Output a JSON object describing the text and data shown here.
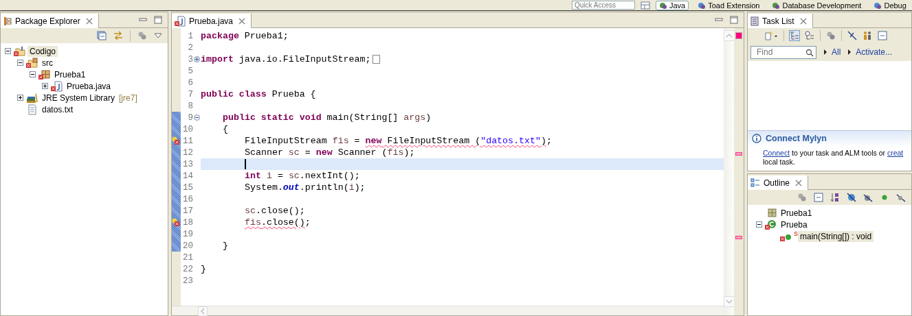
{
  "toolbar": {
    "quick_access": {
      "placeholder": "Quick Access"
    },
    "perspectives": [
      {
        "label": "Java",
        "selected": true
      },
      {
        "label": "Toad Extension",
        "selected": false
      },
      {
        "label": "Database Development",
        "selected": false
      },
      {
        "label": "Debug",
        "selected": false
      }
    ]
  },
  "package_explorer": {
    "title": "Package Explorer",
    "tree": [
      {
        "label": "Codigo",
        "kind": "project",
        "expanded": true,
        "selected": true,
        "error": true,
        "children": [
          {
            "label": "src",
            "kind": "source-folder",
            "expanded": true,
            "selected": false,
            "error": true,
            "children": [
              {
                "label": "Prueba1",
                "kind": "package",
                "expanded": true,
                "selected": false,
                "error": true,
                "children": [
                  {
                    "label": "Prueba.java",
                    "kind": "java-file",
                    "expanded": false,
                    "selected": false,
                    "error": true
                  }
                ]
              }
            ]
          },
          {
            "label": "JRE System Library",
            "decoration": "[jre7]",
            "kind": "library",
            "expanded": false,
            "selected": false,
            "error": false
          },
          {
            "label": "datos.txt",
            "kind": "text-file",
            "selected": false,
            "error": false
          }
        ]
      }
    ]
  },
  "editor": {
    "tab": {
      "title": "Prueba.java",
      "error": true
    },
    "lines": [
      {
        "number": "1",
        "error": false,
        "changed": false,
        "current": false,
        "segments": [
          {
            "t": "package",
            "kind": "keyword",
            "squiggly": false
          },
          {
            "t": " Prueba1;",
            "kind": "plain",
            "squiggly": false
          }
        ]
      },
      {
        "number": "2",
        "error": false,
        "changed": false,
        "current": false
      },
      {
        "number": "3",
        "expanded": false,
        "error": false,
        "changed": false,
        "current": false,
        "segments": [
          {
            "t": "import",
            "kind": "keyword",
            "squiggly": false
          },
          {
            "t": " java.io.FileInputStream;",
            "kind": "plain",
            "squiggly": false
          }
        ]
      },
      {
        "number": "5",
        "error": false,
        "changed": false,
        "current": false
      },
      {
        "number": "6",
        "error": false,
        "changed": false,
        "current": false
      },
      {
        "number": "7",
        "error": false,
        "changed": false,
        "current": false,
        "segments": [
          {
            "t": "public class",
            "kind": "keyword",
            "squiggly": false
          },
          {
            "t": " Prueba {",
            "kind": "plain",
            "squiggly": false
          }
        ],
        "children": [
          {
            "number": "8",
            "error": false,
            "changed": false,
            "current": false
          },
          {
            "number": "9",
            "expanded": true,
            "error": false,
            "changed": true,
            "current": false,
            "segments": [
              {
                "t": "public static void",
                "kind": "keyword",
                "squiggly": false
              },
              {
                "t": " main(String[] ",
                "kind": "plain",
                "squiggly": false
              },
              {
                "t": "args",
                "kind": "variable",
                "squiggly": false
              },
              {
                "t": ")",
                "kind": "plain",
                "squiggly": false
              }
            ]
          },
          {
            "number": "10",
            "error": false,
            "changed": true,
            "current": false,
            "segments": [
              {
                "t": "{",
                "kind": "plain",
                "squiggly": false
              }
            ],
            "children": [
              {
                "number": "11",
                "error": true,
                "changed": true,
                "current": false,
                "segments": [
                  {
                    "t": "FileInputStream ",
                    "kind": "plain",
                    "squiggly": false
                  },
                  {
                    "t": "fis",
                    "kind": "variable",
                    "squiggly": false
                  },
                  {
                    "t": " = ",
                    "kind": "plain",
                    "squiggly": false
                  },
                  {
                    "t": "new",
                    "kind": "keyword",
                    "squiggly": true
                  },
                  {
                    "t": " FileInputStream (",
                    "kind": "plain",
                    "squiggly": true
                  },
                  {
                    "t": "\"datos.txt\"",
                    "kind": "string",
                    "squiggly": true
                  },
                  {
                    "t": ")",
                    "kind": "plain",
                    "squiggly": true
                  },
                  {
                    "t": ";",
                    "kind": "plain",
                    "squiggly": false
                  }
                ]
              },
              {
                "number": "12",
                "error": false,
                "changed": true,
                "current": false,
                "segments": [
                  {
                    "t": "Scanner ",
                    "kind": "plain",
                    "squiggly": false
                  },
                  {
                    "t": "sc",
                    "kind": "variable",
                    "squiggly": false
                  },
                  {
                    "t": " = ",
                    "kind": "plain",
                    "squiggly": false
                  },
                  {
                    "t": "new",
                    "kind": "keyword",
                    "squiggly": false
                  },
                  {
                    "t": " Scanner (",
                    "kind": "plain",
                    "squiggly": false
                  },
                  {
                    "t": "fis",
                    "kind": "variable",
                    "squiggly": false
                  },
                  {
                    "t": ");",
                    "kind": "plain",
                    "squiggly": false
                  }
                ]
              },
              {
                "number": "13",
                "error": false,
                "changed": true,
                "current": true
              },
              {
                "number": "14",
                "error": false,
                "changed": true,
                "current": false,
                "segments": [
                  {
                    "t": "int",
                    "kind": "keyword",
                    "squiggly": false
                  },
                  {
                    "t": " i",
                    "kind": "variable",
                    "squiggly": false
                  },
                  {
                    "t": " = ",
                    "kind": "plain",
                    "squiggly": false
                  },
                  {
                    "t": "sc",
                    "kind": "variable",
                    "squiggly": false
                  },
                  {
                    "t": ".nextInt();",
                    "kind": "plain",
                    "squiggly": false
                  }
                ]
              },
              {
                "number": "15",
                "error": false,
                "changed": true,
                "current": false,
                "segments": [
                  {
                    "t": "System.",
                    "kind": "plain",
                    "squiggly": false
                  },
                  {
                    "t": "out",
                    "kind": "static-field",
                    "squiggly": false
                  },
                  {
                    "t": ".println(",
                    "kind": "plain",
                    "squiggly": false
                  },
                  {
                    "t": "i",
                    "kind": "variable",
                    "squiggly": false
                  },
                  {
                    "t": ");",
                    "kind": "plain",
                    "squiggly": false
                  }
                ]
              },
              {
                "number": "16",
                "error": false,
                "changed": true,
                "current": false
              },
              {
                "number": "17",
                "error": false,
                "changed": true,
                "current": false,
                "segments": [
                  {
                    "t": "sc",
                    "kind": "variable",
                    "squiggly": false
                  },
                  {
                    "t": ".close();",
                    "kind": "plain",
                    "squiggly": false
                  }
                ]
              },
              {
                "number": "18",
                "error": true,
                "changed": true,
                "current": false,
                "segments": [
                  {
                    "t": "fis",
                    "kind": "variable",
                    "squiggly": true
                  },
                  {
                    "t": ".close()",
                    "kind": "plain",
                    "squiggly": true
                  },
                  {
                    "t": ";",
                    "kind": "plain",
                    "squiggly": false
                  }
                ]
              },
              {
                "number": "19",
                "error": false,
                "changed": true,
                "current": false
              }
            ]
          },
          {
            "number": "20",
            "error": false,
            "changed": true,
            "current": false,
            "segments": [
              {
                "t": "}",
                "kind": "plain",
                "squiggly": false
              }
            ]
          }
        ]
      },
      {
        "number": "21",
        "error": false,
        "changed": false,
        "current": false
      },
      {
        "number": "22",
        "error": false,
        "changed": false,
        "current": false,
        "segments": [
          {
            "t": "}",
            "kind": "plain",
            "squiggly": false
          }
        ]
      },
      {
        "number": "23",
        "error": false,
        "changed": false,
        "current": false
      }
    ]
  },
  "task_list": {
    "title": "Task List",
    "find": {
      "placeholder": "Find"
    },
    "links": [
      "All",
      "Activate..."
    ]
  },
  "connect_mylyn": {
    "title": "Connect Mylyn",
    "link": "Connect",
    "text": " to your task and ALM tools or ",
    "link_2": "creat",
    "text_2": "local task."
  },
  "outline": {
    "title": "Outline",
    "tree": [
      {
        "label": "Prueba1",
        "kind": "package",
        "selected": false,
        "error": false
      },
      {
        "label": "Prueba",
        "kind": "class",
        "expanded": true,
        "selected": false,
        "error": true,
        "children": [
          {
            "label": "main(String[]) : void",
            "kind": "method",
            "modifier": "S",
            "selected": true,
            "error": true
          }
        ]
      }
    ]
  }
}
